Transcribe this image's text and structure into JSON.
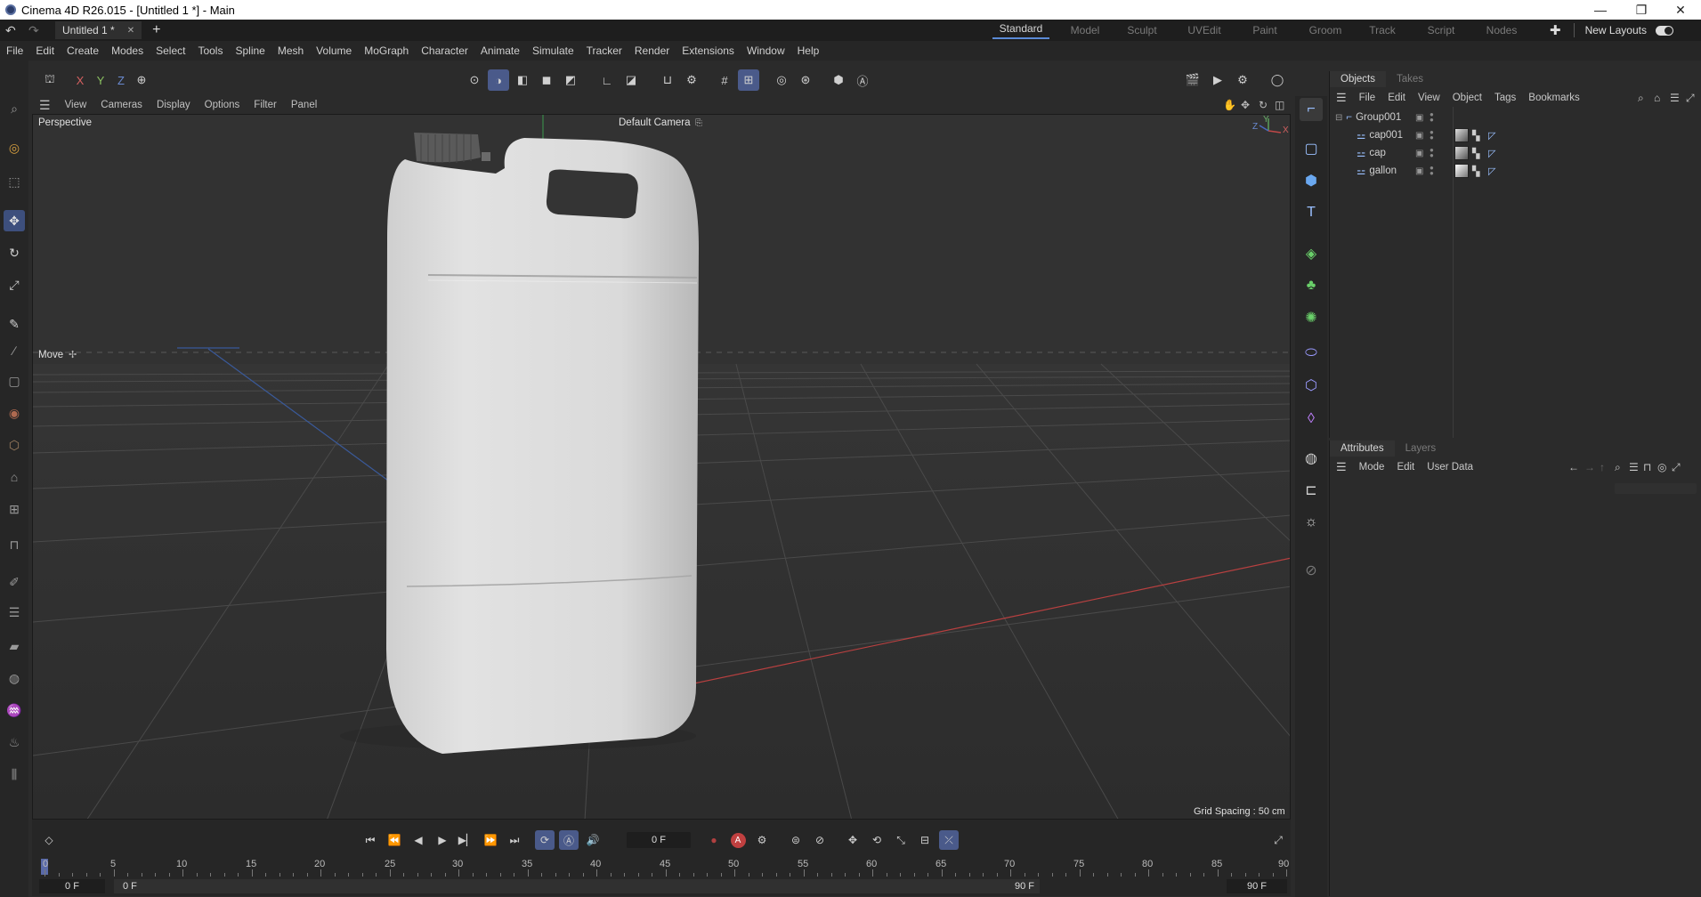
{
  "window": {
    "title": "Cinema 4D R26.015 - [Untitled 1 *] - Main",
    "minimize": "—",
    "maximize": "❐",
    "close": "✕"
  },
  "tabs": {
    "document": "Untitled 1 *",
    "close_glyph": "✕",
    "add_glyph": "+"
  },
  "layouts": {
    "items": [
      "Standard",
      "Model",
      "Sculpt",
      "UVEdit",
      "Paint",
      "Groom",
      "Track",
      "Script",
      "Nodes"
    ],
    "active": "Standard",
    "new_layouts": "New Layouts"
  },
  "menu": [
    "File",
    "Edit",
    "Create",
    "Modes",
    "Select",
    "Tools",
    "Spline",
    "Mesh",
    "Volume",
    "MoGraph",
    "Character",
    "Animate",
    "Simulate",
    "Tracker",
    "Render",
    "Extensions",
    "Window",
    "Help"
  ],
  "axes": {
    "x": "X",
    "y": "Y",
    "z": "Z"
  },
  "viewport": {
    "menu": [
      "View",
      "Cameras",
      "Display",
      "Options",
      "Filter",
      "Panel"
    ],
    "projection": "Perspective",
    "camera": "Default Camera",
    "tool_hint": "Move",
    "grid_spacing": "Grid Spacing : 50 cm",
    "gizmo": {
      "y": "Y",
      "z": "Z",
      "x": "X"
    }
  },
  "objects_panel": {
    "tabs": [
      "Objects",
      "Takes"
    ],
    "menu": [
      "File",
      "Edit",
      "View",
      "Object",
      "Tags",
      "Bookmarks"
    ],
    "rows": [
      {
        "name": "Group001",
        "indent": 0,
        "type": "null"
      },
      {
        "name": "cap001",
        "indent": 1,
        "type": "mesh"
      },
      {
        "name": "cap",
        "indent": 1,
        "type": "mesh"
      },
      {
        "name": "gallon",
        "indent": 1,
        "type": "mesh"
      }
    ]
  },
  "attributes_panel": {
    "tabs": [
      "Attributes",
      "Layers"
    ],
    "menu": [
      "Mode",
      "Edit",
      "User Data"
    ]
  },
  "timeline": {
    "current_frame": "0 F",
    "ruler_labels": [
      "0",
      "5",
      "10",
      "15",
      "20",
      "25",
      "30",
      "35",
      "40",
      "45",
      "50",
      "55",
      "60",
      "65",
      "70",
      "75",
      "80",
      "85",
      "90"
    ],
    "start_field": "0 F",
    "start_field2": "0 F",
    "end_field": "90 F",
    "end_field2": "90 F"
  },
  "colors": {
    "accent": "#4a5a8a",
    "viewport_bg": "#323232",
    "object_surface": "#d8d8d8",
    "x_axis": "#b84040",
    "z_axis": "#3a5a9a",
    "y_axis": "#3a8a4a"
  }
}
